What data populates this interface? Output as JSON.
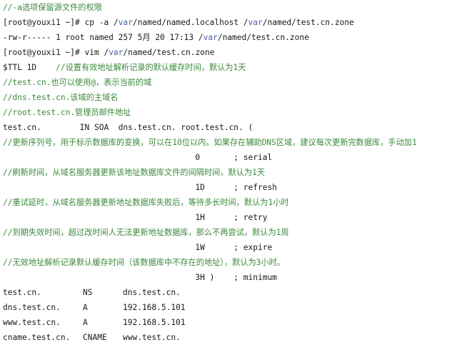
{
  "lines": [
    {
      "segments": [
        {
          "text": "//-a选项保留源文件的权限",
          "style": "comment"
        }
      ]
    },
    {
      "segments": [
        {
          "text": "[root@youxi1 ~]# cp -a /",
          "style": "plain"
        },
        {
          "text": "var",
          "style": "path"
        },
        {
          "text": "/named/named.localhost /",
          "style": "plain"
        },
        {
          "text": "var",
          "style": "path"
        },
        {
          "text": "/named/test.cn.zone",
          "style": "plain"
        }
      ]
    },
    {
      "segments": [
        {
          "text": "-rw-r----- 1 root named 257 5月 20 17:13 /",
          "style": "plain"
        },
        {
          "text": "var",
          "style": "path"
        },
        {
          "text": "/named/test.cn.zone",
          "style": "plain"
        }
      ]
    },
    {
      "segments": [
        {
          "text": "[root@youxi1 ~]# vim /",
          "style": "plain"
        },
        {
          "text": "var",
          "style": "path"
        },
        {
          "text": "/named/test.cn.zone",
          "style": "plain"
        }
      ]
    },
    {
      "segments": [
        {
          "text": "$TTL 1D    ",
          "style": "plain"
        },
        {
          "text": "//设置有效地址解析记录的默认缓存时间，默认为1天",
          "style": "comment"
        }
      ]
    },
    {
      "segments": [
        {
          "text": "//test.cn.也可以使用@，表示当前的域",
          "style": "comment"
        }
      ]
    },
    {
      "segments": [
        {
          "text": "//dns.test.cn.该域的主域名",
          "style": "comment"
        }
      ]
    },
    {
      "segments": [
        {
          "text": "//root.test.cn.管理员邮件地址",
          "style": "comment"
        }
      ]
    },
    {
      "segments": [
        {
          "text": "test.cn.        IN SOA  dns.test.cn. root.test.cn. (",
          "style": "plain"
        }
      ]
    },
    {
      "segments": [
        {
          "text": "//更新序列号，用于标示数据库的变换，可以在10位以内。如果存在辅助DNS区域，建议每次更新完数据库，手动加1",
          "style": "comment"
        }
      ]
    },
    {
      "segments": [
        {
          "text": "                                        0       ; serial",
          "style": "plain"
        }
      ]
    },
    {
      "segments": [
        {
          "text": "//刷新时间，从域名服务器更新该地址数据库文件的间隔时间，默认为1天",
          "style": "comment"
        }
      ]
    },
    {
      "segments": [
        {
          "text": "                                        1D      ; refresh",
          "style": "plain"
        }
      ]
    },
    {
      "segments": [
        {
          "text": "//重试延时，从域名服务器更新地址数据库失败后，等待多长时间，默认为1小时",
          "style": "comment"
        }
      ]
    },
    {
      "segments": [
        {
          "text": "                                        1H      ; retry",
          "style": "plain"
        }
      ]
    },
    {
      "segments": [
        {
          "text": "//到期失效时间，超过改时间人无法更新地址数据库，那么不再尝试，默认为1周",
          "style": "comment"
        }
      ]
    },
    {
      "segments": [
        {
          "text": "                                        1W      ; expire",
          "style": "plain"
        }
      ]
    },
    {
      "segments": [
        {
          "text": "//无效地址解析记录默认缓存时间（该数据库中不存在的地址），默认为3小时。",
          "style": "comment"
        }
      ]
    },
    {
      "segments": [
        {
          "text": "                                        3H )    ; minimum",
          "style": "plain"
        }
      ]
    }
  ],
  "records": [
    {
      "name": "test.cn.",
      "type": "NS",
      "value": "dns.test.cn."
    },
    {
      "name": "dns.test.cn.",
      "type": "A",
      "value": "192.168.5.101"
    },
    {
      "name": "www.test.cn.",
      "type": "A",
      "value": "192.168.5.101"
    },
    {
      "name": "cname.test.cn.",
      "type": "CNAME",
      "value": "www.test.cn."
    }
  ],
  "colors": {
    "comment": "#3a8a3a",
    "path": "#4b5fa8",
    "text": "#1a1a1a"
  }
}
